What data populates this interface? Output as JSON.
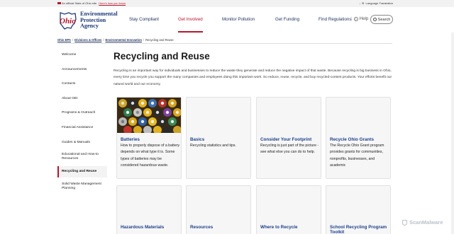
{
  "topbar": {
    "official_text": "An official State of Ohio site.",
    "official_link": "Here's how you know",
    "language": "Language Translation"
  },
  "logo": {
    "line1": "Environmental",
    "line2": "Protection",
    "line3": "Agency",
    "mark": "Ohio"
  },
  "nav": {
    "items": [
      "Stay Compliant",
      "Get Involved",
      "Monitor Pollution",
      "Get Funding",
      "Find Regulations"
    ],
    "active": "Get Involved",
    "help": "Help",
    "search": "Search"
  },
  "breadcrumb": [
    "Ohio EPA",
    "Divisions & Offices",
    "Environmental Innovation",
    "Recycling and Reuse"
  ],
  "sidebar": {
    "items": [
      {
        "label": "Welcome"
      },
      {
        "label": "Announcements"
      },
      {
        "label": "Contacts"
      },
      {
        "label": "About OEI"
      },
      {
        "label": "Programs & Outreach"
      },
      {
        "label": "Financial Assistance"
      },
      {
        "label": "Guides & Manuals"
      },
      {
        "label": "Educational and How-to Resources"
      },
      {
        "label": "Recycling and Reuse"
      },
      {
        "label": "Solid Waste Management Planning"
      }
    ],
    "active": "Recycling and Reuse"
  },
  "main": {
    "title": "Recycling and Reuse",
    "intro": "Recycling is an important way for individuals and businesses to reduce the waste they generate and reduce the negative impact of that waste. Because recycling is big business in Ohio, every time you recycle you support the many companies and employees doing this important work. So reduce, reuse, recycle, and buy recycled-content products. Your efforts benefit our natural world and our economy.",
    "cards": [
      {
        "title": "Batteries",
        "body": "How to properly dispose of a battery depends on what type it is. Some types of batteries may be considered hazardous waste."
      },
      {
        "title": "Basics",
        "body": "Recycling statistics and tips."
      },
      {
        "title": "Consider Your Footprint",
        "body": "Recycling is just part of the picture - see what else you can do to help."
      },
      {
        "title": "Recycle Ohio Grants",
        "body": "The Recycle Ohio Grant program provides grants for communities, nonprofits, businesses, and academic"
      },
      {
        "title": "Hazardous Materials",
        "body": ""
      },
      {
        "title": "Resources",
        "body": ""
      },
      {
        "title": "Where to Recycle",
        "body": ""
      },
      {
        "title": "School Recycling Program Toolkit",
        "body": ""
      }
    ]
  },
  "watermark": "ScanMalware",
  "colors": {
    "accent": "#b5162b",
    "brand": "#1f3a7a",
    "link": "#1e3f8a"
  }
}
